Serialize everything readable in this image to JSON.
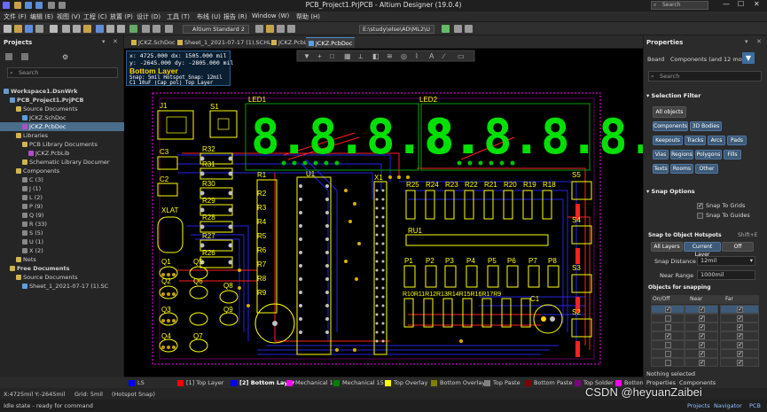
{
  "title_bar": {
    "title": "PCB_Project1.PrjPCB - Altium Designer (19.0.4)",
    "search_placeholder": "Search"
  },
  "menu": [
    "文件 (F)",
    "编辑 (E)",
    "视图 (V)",
    "工程 (C)",
    "放置 (P)",
    "设计 (D)",
    "工具 (T)",
    "布线 (U)",
    "报告 (R)",
    "Window (W)",
    "帮助 (H)"
  ],
  "toolbar": {
    "standard_combo": "Altium Standard 2",
    "path_combo": "E:\\study\\else\\AD\\ML2\\U"
  },
  "projects_panel": {
    "title": "Projects",
    "search_placeholder": "Search",
    "tree": [
      {
        "label": "Workspace1.DsnWrk",
        "indent": 0,
        "bold": true
      },
      {
        "label": "PCB_Project1.PrjPCB",
        "indent": 1,
        "bold": true
      },
      {
        "label": "Source Documents",
        "indent": 2
      },
      {
        "label": "JCKZ.SchDoc",
        "indent": 3
      },
      {
        "label": "JCKZ.PcbDoc",
        "indent": 3,
        "selected": true
      },
      {
        "label": "Libraries",
        "indent": 2
      },
      {
        "label": "PCB Library Documents",
        "indent": 3
      },
      {
        "label": "JCKZ.PcbLib",
        "indent": 4
      },
      {
        "label": "Schematic Library Documer",
        "indent": 3
      },
      {
        "label": "Components",
        "indent": 2
      },
      {
        "label": "C (3)",
        "indent": 3
      },
      {
        "label": "J (1)",
        "indent": 3
      },
      {
        "label": "L (2)",
        "indent": 3
      },
      {
        "label": "P (9)",
        "indent": 3
      },
      {
        "label": "Q (9)",
        "indent": 3
      },
      {
        "label": "R (33)",
        "indent": 3
      },
      {
        "label": "S (5)",
        "indent": 3
      },
      {
        "label": "U (1)",
        "indent": 3
      },
      {
        "label": "X (2)",
        "indent": 3
      },
      {
        "label": "Nets",
        "indent": 2
      },
      {
        "label": "Free Documents",
        "indent": 1,
        "bold": true
      },
      {
        "label": "Source Documents",
        "indent": 2
      },
      {
        "label": "Sheet_1_2021-07-17 (1).SC",
        "indent": 3
      }
    ]
  },
  "doc_tabs": [
    {
      "label": "JCKZ.SchDoc",
      "active": false
    },
    {
      "label": "Sheet_1_2021-07-17 (1).SCHLIB",
      "active": false
    },
    {
      "label": "JCKZ.PcbLib",
      "active": false
    },
    {
      "label": "JCKZ.PcbDoc",
      "active": true
    }
  ],
  "hud": {
    "line1": "x: 4725.000  dx: 1505.000 mil",
    "line2": "y: -2645.000  dy: -2805.000 mil",
    "layer": "Bottom Layer",
    "line4": "Snap: 5mil Hotspot Snap: 12mil",
    "line5": "C1 10uF (Cap_pol) Top Layer"
  },
  "pcb_labels": {
    "designators": [
      "J1",
      "S1",
      "LED1",
      "LED2",
      "C3",
      "R32",
      "R31",
      "C2",
      "R30",
      "R29",
      "XLAT",
      "R28",
      "R27",
      "R26",
      "Q1",
      "Q2",
      "Q5",
      "Q6",
      "Q8",
      "Q3",
      "Q9",
      "Q4",
      "Q7",
      "R1",
      "R2",
      "R3",
      "R4",
      "R5",
      "R6",
      "R7",
      "R8",
      "R9",
      "U1",
      "X1",
      "R25",
      "R24",
      "R23",
      "R22",
      "R21",
      "R20",
      "R19",
      "R18",
      "S5",
      "S4",
      "RU1",
      "P1",
      "P2",
      "P3",
      "P4",
      "P5",
      "P6",
      "P7",
      "P8",
      "S3",
      "R10",
      "R11",
      "R12",
      "R13",
      "R14",
      "R15",
      "R16",
      "R17",
      "C1",
      "S2"
    ],
    "resistor_row": "R10R11R12R13R14R15R16R17R9"
  },
  "layers": [
    {
      "label": "LS",
      "color": "#0000ff"
    },
    {
      "label": "[1] Top Layer",
      "color": "#ff0000"
    },
    {
      "label": "[2] Bottom Layer",
      "color": "#0000ff",
      "active": true
    },
    {
      "label": "Mechanical 1",
      "color": "#ff00ff"
    },
    {
      "label": "Mechanical 15",
      "color": "#008000"
    },
    {
      "label": "Top Overlay",
      "color": "#ffff00"
    },
    {
      "label": "Bottom Overlay",
      "color": "#808000"
    },
    {
      "label": "Top Paste",
      "color": "#808080"
    },
    {
      "label": "Bottom Paste",
      "color": "#800000"
    },
    {
      "label": "Top Solder",
      "color": "#800080"
    },
    {
      "label": "Botton",
      "color": "#ff00ff"
    }
  ],
  "status": {
    "coords": "X:4725mil Y:-2645mil",
    "grid": "Grid: 5mil",
    "snap": "(Hotspot Snap)",
    "state": "Idle state - ready for command",
    "bottom_tabs": [
      "Projects",
      "Navigator",
      "PCB"
    ]
  },
  "properties": {
    "title": "Properties",
    "board_label": "Board",
    "components_label": "Components (and 12 more)",
    "search_placeholder": "Search",
    "selection_filter": "Selection Filter",
    "all_objects": "All objects",
    "filter_buttons": [
      "Components",
      "3D Bodies",
      "Keepouts",
      "Tracks",
      "Arcs",
      "Pads",
      "Vias",
      "Regions",
      "Polygons",
      "Fills",
      "Texts",
      "Rooms",
      "Other"
    ],
    "snap_options": "Snap Options",
    "snap_to_grids": "Snap To Grids",
    "snap_to_guides": "Snap To Guides",
    "snap_hotspots": "Snap to Object Hotspots",
    "shortcut": "Shift+E",
    "layer_modes": [
      "All Layers",
      "Current Layer",
      "Off"
    ],
    "snap_distance_label": "Snap Distance",
    "snap_distance_value": "12mil",
    "near_range_label": "Near Range",
    "near_range_value": "1000mil",
    "objects_for_snapping": "Objects for snapping",
    "grid_headers": [
      "On/Off",
      "Near",
      "Far"
    ],
    "nothing_selected": "Nothing selected",
    "bottom_tabs": [
      "Properties",
      "Components"
    ]
  },
  "watermark": "CSDN @heyuanZaibei",
  "colors": {
    "accent": "#4a8ad0",
    "segment_on": "#00e000",
    "overlay": "#ffff00",
    "top_layer": "#ff0000",
    "bottom_layer": "#0000ff"
  }
}
